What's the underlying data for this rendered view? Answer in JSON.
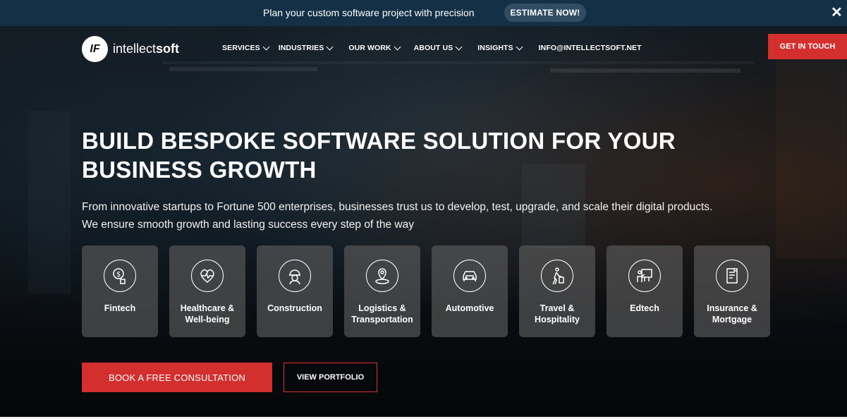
{
  "announcement": {
    "text": "Plan your custom software project with precision",
    "button_label": "ESTIMATE NOW!",
    "close_glyph": "✕"
  },
  "header": {
    "logo_mark": "IF",
    "logo_text_light": "intellect",
    "logo_text_bold": "soft",
    "nav": [
      {
        "label": "SERVICES",
        "has_dropdown": true
      },
      {
        "label": "INDUSTRIES",
        "has_dropdown": true
      },
      {
        "label": "OUR WORK",
        "has_dropdown": true
      },
      {
        "label": "ABOUT US",
        "has_dropdown": true
      },
      {
        "label": "INSIGHTS",
        "has_dropdown": true
      },
      {
        "label": "INFO@INTELLECTSOFT.NET",
        "has_dropdown": false
      }
    ],
    "cta_label": "GET IN TOUCH"
  },
  "hero": {
    "headline_line1": "BUILD BESPOKE SOFTWARE SOLUTION FOR YOUR",
    "headline_line2": "BUSINESS GROWTH",
    "subtext_line1": "From innovative startups to Fortune 500 enterprises, businesses trust us to develop, test, upgrade, and scale their digital products.",
    "subtext_line2": "We ensure smooth growth and lasting success every step of the way",
    "industries": [
      {
        "line1": "Fintech",
        "line2": "",
        "icon": "fintech-icon"
      },
      {
        "line1": "Healthcare &",
        "line2": "Well-being",
        "icon": "healthcare-icon"
      },
      {
        "line1": "Construction",
        "line2": "",
        "icon": "construction-icon"
      },
      {
        "line1": "Logistics &",
        "line2": "Transportation",
        "icon": "logistics-icon"
      },
      {
        "line1": "Automotive",
        "line2": "",
        "icon": "automotive-icon"
      },
      {
        "line1": "Travel &",
        "line2": "Hospitality",
        "icon": "travel-icon"
      },
      {
        "line1": "Edtech",
        "line2": "",
        "icon": "edtech-icon"
      },
      {
        "line1": "Insurance &",
        "line2": "Mortgage",
        "icon": "insurance-icon"
      }
    ],
    "primary_button": "BOOK A FREE CONSULTATION",
    "secondary_button": "VIEW PORTFOLIO"
  },
  "colors": {
    "accent_red": "#d32f2f",
    "topbar_bg": "#143047",
    "card_bg": "#5f5f5f"
  }
}
